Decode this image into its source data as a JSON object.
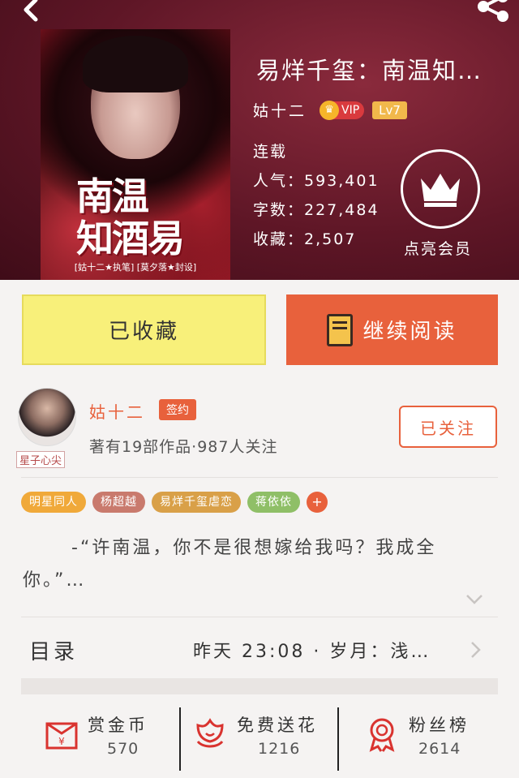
{
  "book": {
    "title": "易烊千玺：南温知…",
    "author": "姑十二",
    "vip_badge": "VIP",
    "level_badge": "Lv7",
    "status": "连载",
    "popularity": "人气：593,401",
    "word_count": "字数：227,484",
    "favorites": "收藏：2,507",
    "cover": {
      "title_line1": "南温",
      "title_line2": "知酒易",
      "credit": "[姑十二★执笔] [莫夕落★封设]"
    }
  },
  "vip_member": {
    "label": "点亮会员",
    "icon": "crown-icon"
  },
  "actions": {
    "collect_label": "已收藏",
    "read_label": "继续阅读",
    "collect_color": "#f8f07a",
    "read_color": "#e8613c"
  },
  "author_card": {
    "name": "姑十二",
    "signed_badge": "签约",
    "avatar_tag": "星子心尖",
    "info": "著有19部作品·987人关注",
    "follow_label": "已关注"
  },
  "tags": [
    {
      "label": "明星同人",
      "color": "#f0a93a"
    },
    {
      "label": "杨超越",
      "color": "#c97a6d"
    },
    {
      "label": "易烊千玺虐恋",
      "color": "#d9a048"
    },
    {
      "label": "蒋依依",
      "color": "#8fbf67"
    }
  ],
  "tag_more": "+",
  "summary": "-“许南温，你不是很想嫁给我吗？我成全你。”…",
  "toc": {
    "label": "目录",
    "latest": "昨天 23:08 · 岁月：浅…"
  },
  "bottom_bar": [
    {
      "label": "赏金币",
      "count": "570",
      "icon": "red-envelope-icon"
    },
    {
      "label": "免费送花",
      "count": "1216",
      "icon": "flower-icon"
    },
    {
      "label": "粉丝榜",
      "count": "2614",
      "icon": "medal-icon"
    }
  ],
  "colors": {
    "accent": "#e8613c",
    "header_bg": "#5e1626"
  }
}
